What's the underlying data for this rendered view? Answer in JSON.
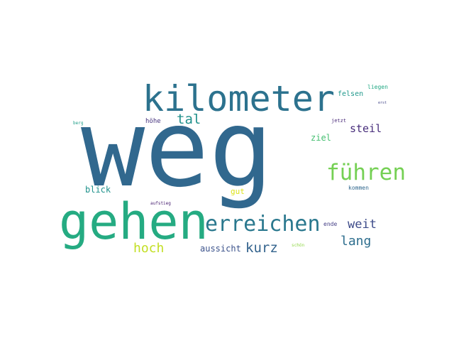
{
  "wordcloud": {
    "background": "#ffffff",
    "words": {
      "weg": {
        "text": "weg",
        "color": "#31688e"
      },
      "kilometer": {
        "text": "kilometer",
        "color": "#2c728e"
      },
      "gehen": {
        "text": "gehen",
        "color": "#25ab82"
      },
      "fuehren": {
        "text": "führen",
        "color": "#75d054"
      },
      "erreichen": {
        "text": "erreichen",
        "color": "#2a788e"
      },
      "kurz": {
        "text": "kurz",
        "color": "#33638d"
      },
      "tal": {
        "text": "tal",
        "color": "#21918c"
      },
      "weit": {
        "text": "weit",
        "color": "#3e4c8a"
      },
      "lang": {
        "text": "lang",
        "color": "#2e6e8e"
      },
      "hoch": {
        "text": "hoch",
        "color": "#c2df23"
      },
      "steil": {
        "text": "steil",
        "color": "#472d7b"
      },
      "ziel": {
        "text": "ziel",
        "color": "#44bf70"
      },
      "blick": {
        "text": "blick",
        "color": "#20928c"
      },
      "aussicht": {
        "text": "aussicht",
        "color": "#3b528b"
      },
      "gut": {
        "text": "gut",
        "color": "#dde318"
      },
      "felsen": {
        "text": "felsen",
        "color": "#1f988b"
      },
      "hoehe": {
        "text": "höhe",
        "color": "#46337e"
      },
      "liegen": {
        "text": "liegen",
        "color": "#22a884"
      },
      "kommen": {
        "text": "kommen",
        "color": "#31688e"
      },
      "ende": {
        "text": "ende",
        "color": "#433e85"
      },
      "jetzt": {
        "text": "jetzt",
        "color": "#482878"
      },
      "aufstieg": {
        "text": "aufstieg",
        "color": "#482071"
      },
      "schon": {
        "text": "schön",
        "color": "#8fd744"
      },
      "berg": {
        "text": "berg",
        "color": "#1f9e89"
      },
      "erst": {
        "text": "erst",
        "color": "#414487"
      }
    }
  }
}
